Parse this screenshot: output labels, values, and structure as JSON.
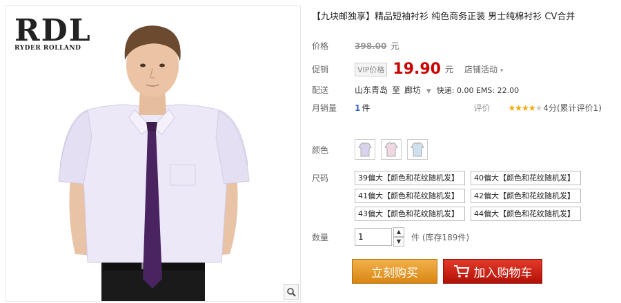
{
  "logo": {
    "mark": "RDL",
    "sub": "RYDER ROLLAND"
  },
  "product": {
    "title": "【九块邮独享】精品短袖衬衫 纯色商务正装 男士纯棉衬衫 CV合并"
  },
  "price": {
    "label": "价格",
    "original": "398.00",
    "unit": "元"
  },
  "promo": {
    "label": "促销",
    "vip_tag": "VIP价格",
    "price": "19.90",
    "unit": "元",
    "store_activity": "店铺活动"
  },
  "shipping": {
    "label": "配送",
    "from": "山东青岛",
    "to_word": "至",
    "to": "廊坊",
    "fees": "快递: 0.00 EMS: 22.00"
  },
  "sales": {
    "label": "月销量",
    "count": "1",
    "unit": "件",
    "rating_label": "评价",
    "rating_value": 4,
    "rating_max": 5,
    "rating_text": "4分(累计评价1)"
  },
  "color": {
    "label": "颜色",
    "swatches": [
      {
        "name": "淡紫",
        "hex": "#d9d2ec"
      },
      {
        "name": "粉色",
        "hex": "#f0d8e2"
      },
      {
        "name": "浅蓝",
        "hex": "#cfe0ee"
      }
    ]
  },
  "size": {
    "label": "尺码",
    "options": [
      "39偏大【颜色和花纹随机发】",
      "40偏大【颜色和花纹随机发】",
      "41偏大【颜色和花纹随机发】",
      "42偏大【颜色和花纹随机发】",
      "43偏大【颜色和花纹随机发】",
      "44偏大【颜色和花纹随机发】"
    ]
  },
  "quantity": {
    "label": "数量",
    "value": "1",
    "unit_stock": "件 (库存189件)"
  },
  "buttons": {
    "buy": "立刻购买",
    "cart": "加入购物车"
  },
  "colors": {
    "price_red": "#cc0000",
    "star": "#f4a800",
    "buy_orange": "#e09a2a",
    "cart_red": "#c81a0c"
  }
}
